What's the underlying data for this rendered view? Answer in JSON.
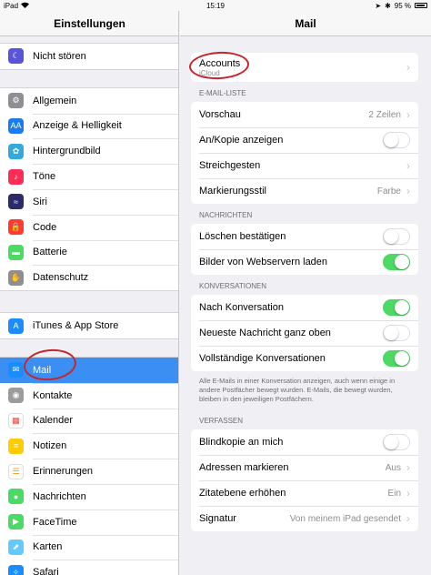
{
  "status_bar": {
    "device": "iPad",
    "time": "15:19",
    "battery": "95 %"
  },
  "sidebar": {
    "title": "Einstellungen",
    "groups": [
      [
        {
          "label": "Nicht stören",
          "icon": "moon-icon",
          "color": "#5856d6",
          "glyph": "☾"
        }
      ],
      [
        {
          "label": "Allgemein",
          "icon": "gear-icon",
          "color": "#8e8e93",
          "glyph": "⚙"
        },
        {
          "label": "Anzeige & Helligkeit",
          "icon": "brightness-icon",
          "color": "#1a7cf5",
          "glyph": "AA"
        },
        {
          "label": "Hintergrundbild",
          "icon": "wallpaper-icon",
          "color": "#34aadc",
          "glyph": "✿"
        },
        {
          "label": "Töne",
          "icon": "speaker-icon",
          "color": "#ff2d55",
          "glyph": "♪"
        },
        {
          "label": "Siri",
          "icon": "siri-icon",
          "color": "#2b2b6b",
          "glyph": "≈"
        },
        {
          "label": "Code",
          "icon": "lock-icon",
          "color": "#ff3b30",
          "glyph": "🔒"
        },
        {
          "label": "Batterie",
          "icon": "battery-icon",
          "color": "#4cd964",
          "glyph": "▬"
        },
        {
          "label": "Datenschutz",
          "icon": "hand-icon",
          "color": "#8e8e93",
          "glyph": "✋"
        }
      ],
      [
        {
          "label": "iTunes & App Store",
          "icon": "app-store-icon",
          "color": "#1a8cff",
          "glyph": "A"
        }
      ],
      [
        {
          "label": "Mail",
          "icon": "mail-icon",
          "color": "#1a8cff",
          "glyph": "✉",
          "selected": true
        },
        {
          "label": "Kontakte",
          "icon": "contacts-icon",
          "color": "#9c9c9c",
          "glyph": "◉"
        },
        {
          "label": "Kalender",
          "icon": "calendar-icon",
          "color": "#ffffff",
          "glyph": "▦",
          "glyph_color": "#ff3b30"
        },
        {
          "label": "Notizen",
          "icon": "notes-icon",
          "color": "#ffcc00",
          "glyph": "≡"
        },
        {
          "label": "Erinnerungen",
          "icon": "reminders-icon",
          "color": "#ffffff",
          "glyph": "☰",
          "glyph_color": "#ff9500"
        },
        {
          "label": "Nachrichten",
          "icon": "messages-icon",
          "color": "#4cd964",
          "glyph": "●"
        },
        {
          "label": "FaceTime",
          "icon": "facetime-icon",
          "color": "#4cd964",
          "glyph": "▶"
        },
        {
          "label": "Karten",
          "icon": "maps-icon",
          "color": "#64c8fa",
          "glyph": "⬈"
        },
        {
          "label": "Safari",
          "icon": "safari-icon",
          "color": "#1a8cff",
          "glyph": "✧"
        }
      ]
    ]
  },
  "main": {
    "title": "Mail",
    "account": {
      "title": "Accounts",
      "subtitle": "iCloud"
    },
    "sections": [
      {
        "title": "E-MAIL-LISTE",
        "rows": [
          {
            "label": "Vorschau",
            "value": "2 Zeilen",
            "chevron": true
          },
          {
            "label": "An/Kopie anzeigen",
            "toggle": false
          },
          {
            "label": "Streichgesten",
            "chevron": true
          },
          {
            "label": "Markierungsstil",
            "value": "Farbe",
            "chevron": true
          }
        ]
      },
      {
        "title": "NACHRICHTEN",
        "rows": [
          {
            "label": "Löschen bestätigen",
            "toggle": false
          },
          {
            "label": "Bilder von Webservern laden",
            "toggle": true
          }
        ]
      },
      {
        "title": "KONVERSATIONEN",
        "rows": [
          {
            "label": "Nach Konversation",
            "toggle": true
          },
          {
            "label": "Neueste Nachricht ganz oben",
            "toggle": false
          },
          {
            "label": "Vollständige Konversationen",
            "toggle": true
          }
        ],
        "footer": "Alle E-Mails in einer Konversation anzeigen, auch wenn einige in andere Postfächer bewegt wurden. E-Mails, die bewegt wurden, bleiben in den jeweiligen Postfächern."
      },
      {
        "title": "VERFASSEN",
        "rows": [
          {
            "label": "Blindkopie an mich",
            "toggle": false
          },
          {
            "label": "Adressen markieren",
            "value": "Aus",
            "chevron": true
          },
          {
            "label": "Zitatebene erhöhen",
            "value": "Ein",
            "chevron": true
          },
          {
            "label": "Signatur",
            "value": "Von meinem iPad gesendet",
            "chevron": true
          }
        ]
      }
    ]
  }
}
